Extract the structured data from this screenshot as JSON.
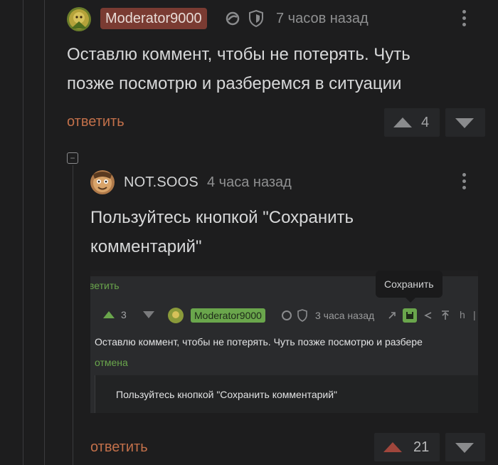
{
  "comment1": {
    "username": "Moderator9000",
    "time": "7 часов назад",
    "text_line1": "Оставлю коммент, чтобы не потерять. Чуть",
    "text_line2": "позже посмотрю и разберемся в ситуации",
    "reply_label": "ответить",
    "rating": "4",
    "badge_color": "#7a3b32"
  },
  "comment2": {
    "collapse_symbol": "−",
    "username": "NOT.SOOS",
    "time": "4 часа назад",
    "text_line1": "Пользуйтесь кнопкой \"Сохранить",
    "text_line2": "комментарий\"",
    "reply_label": "ответить",
    "rating": "21"
  },
  "embedded": {
    "top_reply": "ветить",
    "tooltip": "Сохранить",
    "rating": "3",
    "username": "Moderator9000",
    "time": "3 часа назад",
    "comment": "Оставлю коммент, чтобы не потерять. Чуть позже посмотрю и разбере",
    "cancel": "отмена",
    "reply_text": "Пользуйтесь кнопкой \"Сохранить комментарий\"",
    "accent": "#6aa64c"
  },
  "colors": {
    "background": "#1d1d1e",
    "link": "#c2704a",
    "upvote_active": "#a0463c"
  }
}
